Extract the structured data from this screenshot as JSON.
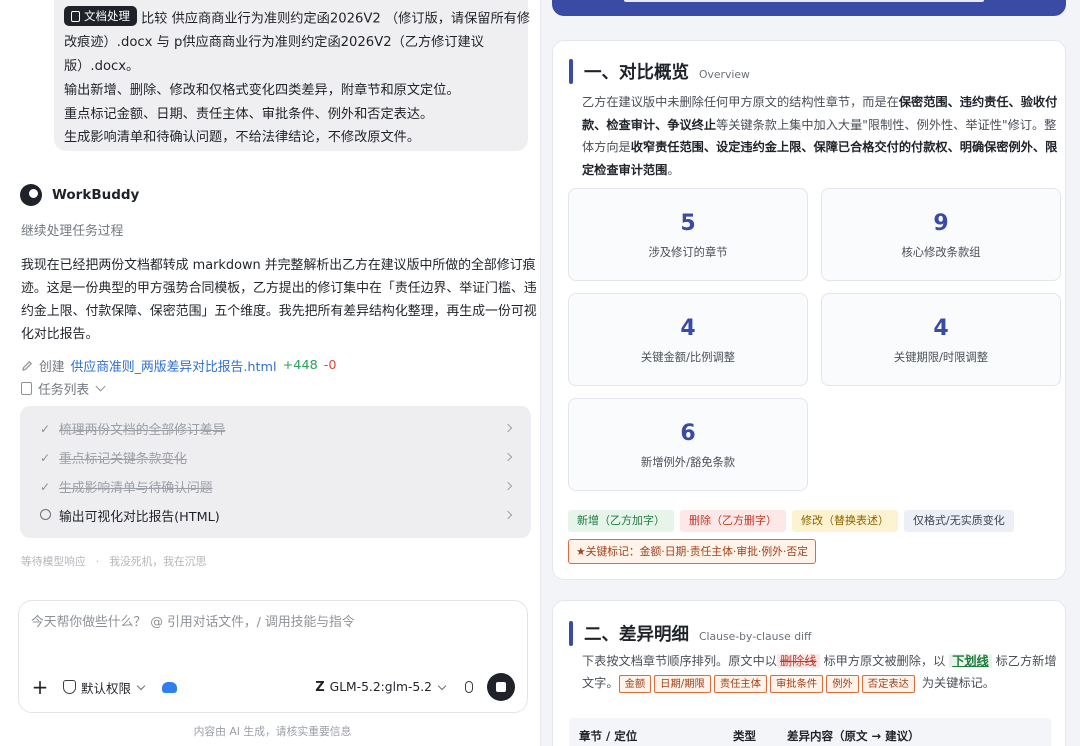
{
  "chat": {
    "user_message": {
      "skill_tag": "文档处理",
      "lines": [
        "比较 供应商商业行为准则约定函2026V2 （修订版，请保留所有修",
        "改痕迹）.docx 与 p供应商商业行为准则约定函2026V2（乙方修订建议",
        "版）.docx。",
        "输出新增、删除、修改和仅格式变化四类差异，附章节和原文定位。",
        "重点标记金额、日期、责任主体、审批条件、例外和否定表达。",
        "生成影响清单和待确认问题，不给法律结论，不修改原文件。"
      ]
    },
    "agent_name": "WorkBuddy",
    "status": "继续处理任务过程",
    "agent_text": [
      "我现在已经把两份文档都转成 markdown 并完整解析出乙方在建议版中所做的全部修订痕",
      "迹。这是一份典型的甲方强势合同模板，乙方提出的修订集中在「责任边界、举证门槛、违",
      "约金上限、付款保障、保密范围」五个维度。我先把所有差异结构化整理，再生成一份可视",
      "化对比报告。"
    ],
    "file_action": {
      "label": "创建",
      "filename": "供应商准则_两版差异对比报告.html",
      "added": "+448",
      "removed": "-0"
    },
    "task_list_label": "任务列表",
    "tasks": [
      {
        "label": "梳理两份文档的全部修订差异",
        "done": true
      },
      {
        "label": "重点标记关键条款变化",
        "done": true
      },
      {
        "label": "生成影响清单与待确认问题",
        "done": true
      },
      {
        "label": "输出可视化对比报告(HTML)",
        "done": false
      }
    ],
    "waiting": [
      "等待模型响应",
      "我没死机，我在沉思"
    ],
    "input": {
      "placeholder": "今天帮你做些什么？ @ 引用对话文件，/ 调用技能与指令",
      "permission": "默认权限",
      "model": "GLM-5.2:glm-5.2"
    },
    "footer_note": "内容由 AI 生成，请核实重要信息"
  },
  "report": {
    "section1": {
      "title": "一、对比概览",
      "subtitle": "Overview",
      "text_lines": [
        [
          {
            "t": "乙方在建议版中未删除任何甲方原文的结构性章节，而是在",
            "b": false
          },
          {
            "t": "保密范围、违约责任、验收付",
            "b": true
          }
        ],
        [
          {
            "t": "款、检查审计、争议终止",
            "b": true
          },
          {
            "t": "等关键条款上集中加入大量\"限制性、例外性、举证性\"修订。整",
            "b": false
          }
        ],
        [
          {
            "t": "体方向是",
            "b": false
          },
          {
            "t": "收窄责任范围、设定违约金上限、保障已合格交付的付款权、明确保密例外、限",
            "b": true
          }
        ],
        [
          {
            "t": "定检查审计范围",
            "b": true
          },
          {
            "t": "。",
            "b": false
          }
        ]
      ],
      "stats": [
        {
          "value": "5",
          "label": "涉及修订的章节"
        },
        {
          "value": "9",
          "label": "核心修改条款组"
        },
        {
          "value": "4",
          "label": "关键金额/比例调整"
        },
        {
          "value": "4",
          "label": "关键期限/时限调整"
        },
        {
          "value": "6",
          "label": "新增例外/豁免条款"
        }
      ],
      "legend": {
        "add": "新增（乙方加字）",
        "del": "删除（乙方删字）",
        "mod": "修改（替换表述）",
        "fmt": "仅格式/无实质变化"
      },
      "key_marks": "★关键标记：金额·日期·责任主体·审批·例外·否定"
    },
    "section2": {
      "title": "二、差异明细",
      "subtitle": "Clause-by-clause diff",
      "line1_a": "下表按文档章节顺序排列。原文中以",
      "del_sample": "删除线",
      "line1_b": "标甲方原文被删除，以",
      "add_sample": "下划线",
      "line1_c": "标乙方新增",
      "line2_a": "文字。",
      "tags": [
        "金额",
        "日期/期限",
        "责任主体",
        "审批条件",
        "例外",
        "否定表达"
      ],
      "line2_b": "为关键标记。",
      "table_headers": [
        "章节 / 定位",
        "类型",
        "差异内容（原文 → 建议）"
      ]
    }
  }
}
